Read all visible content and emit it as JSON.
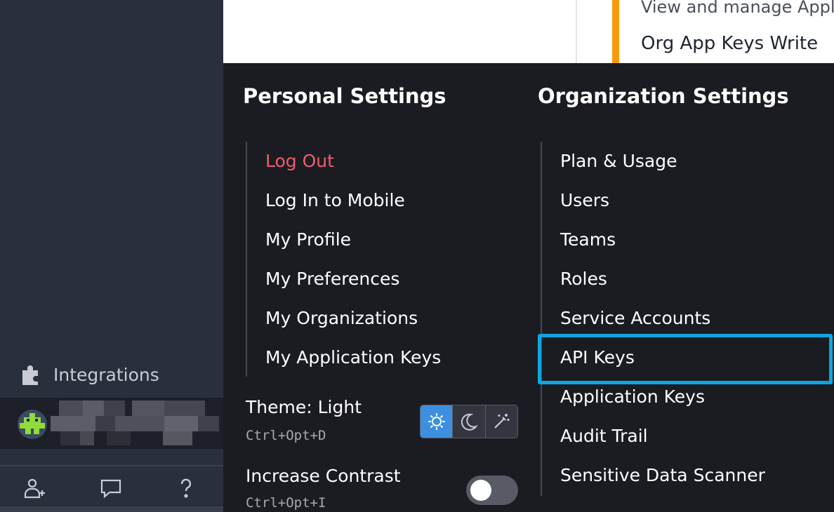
{
  "sidebar": {
    "integrations_label": "Integrations",
    "bottom_icons": [
      "add-user-icon",
      "chat-icon",
      "help-icon"
    ]
  },
  "background_page": {
    "line1": "View and manage Applica",
    "line2": "Org App Keys Write",
    "accent_color": "#f39b0d"
  },
  "personal": {
    "title": "Personal Settings",
    "items": [
      "Log Out",
      "Log In to Mobile",
      "My Profile",
      "My Preferences",
      "My Organizations",
      "My Application Keys"
    ]
  },
  "theme": {
    "label": "Theme: Light",
    "shortcut": "Ctrl+Opt+D",
    "options": [
      "sun-icon",
      "moon-icon",
      "magic-wand-icon"
    ],
    "selected": "sun-icon"
  },
  "contrast": {
    "label": "Increase Contrast",
    "shortcut": "Ctrl+Opt+I",
    "enabled": false
  },
  "organization": {
    "title": "Organization Settings",
    "items": [
      "Plan & Usage",
      "Users",
      "Teams",
      "Roles",
      "Service Accounts",
      "API Keys",
      "Application Keys",
      "Audit Trail",
      "Sensitive Data Scanner"
    ],
    "highlighted": "API Keys"
  },
  "colors": {
    "panel_bg": "#1b1c21",
    "logout": "#f35a70",
    "highlight": "#0ca7e0",
    "selected_theme": "#3d8fe0"
  }
}
